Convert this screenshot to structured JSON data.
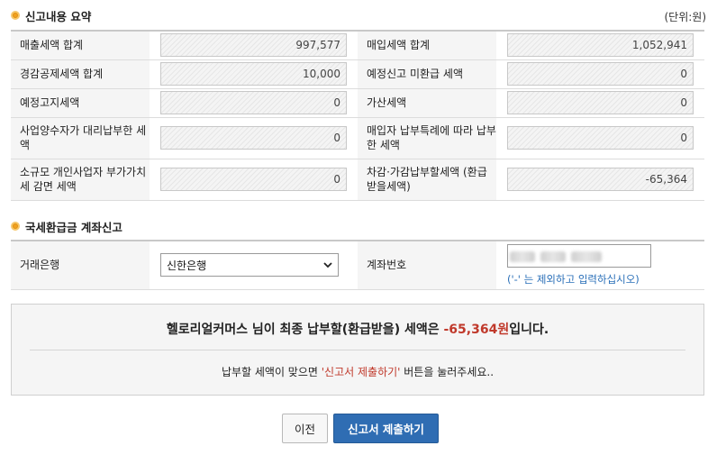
{
  "summary_section": {
    "title": "신고내용 요약",
    "unit": "(단위:원)",
    "rows": [
      [
        {
          "label": "매출세액 합계",
          "value": "997,577"
        },
        {
          "label": "매입세액 합계",
          "value": "1,052,941"
        }
      ],
      [
        {
          "label": "경감공제세액 합계",
          "value": "10,000"
        },
        {
          "label": "예정신고 미환급 세액",
          "value": "0"
        }
      ],
      [
        {
          "label": "예정고지세액",
          "value": "0"
        },
        {
          "label": "가산세액",
          "value": "0"
        }
      ],
      [
        {
          "label": "사업양수자가 대리납부한 세액",
          "value": "0"
        },
        {
          "label": "매입자 납부특례에 따라 납부한 세액",
          "value": "0"
        }
      ],
      [
        {
          "label": "소규모 개인사업자 부가가치세 감면 세액",
          "value": "0"
        },
        {
          "label": "차감·가감납부할세액 (환급받을세액)",
          "value": "-65,364"
        }
      ]
    ]
  },
  "refund_section": {
    "title": "국세환급금 계좌신고",
    "bank_label": "거래은행",
    "bank_selected": "신한은행",
    "account_label": "계좌번호",
    "account_hint": "('-' 는 제외하고 입력하십시오)"
  },
  "result": {
    "message_prefix": "헬로리얼커머스 님이 최종 납부할(환급받을) 세액은 ",
    "amount": "-65,364원",
    "message_suffix": "입니다.",
    "guide_prefix": "납부할 세액이 맞으면 ",
    "guide_highlight": "'신고서 제출하기'",
    "guide_suffix": " 버튼을 눌러주세요.."
  },
  "buttons": {
    "prev": "이전",
    "submit": "신고서 제출하기"
  },
  "colors": {
    "accent_blue": "#2f6db3",
    "highlight_red": "#c0392b",
    "bullet_orange": "#f0a020"
  },
  "icons": {
    "section_bullet": "orange-circle-bullet",
    "select_arrow": "chevron-down"
  }
}
